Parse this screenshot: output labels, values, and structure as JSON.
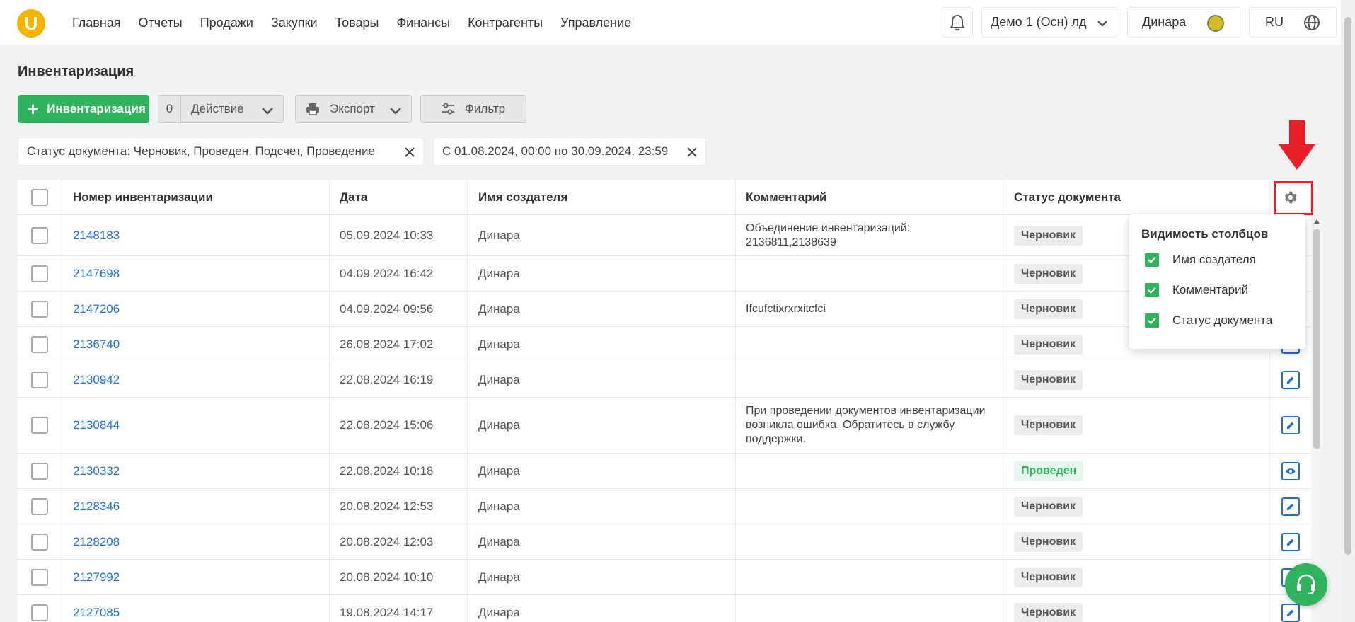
{
  "nav": [
    "Главная",
    "Отчеты",
    "Продажи",
    "Закупки",
    "Товары",
    "Финансы",
    "Контрагенты",
    "Управление"
  ],
  "logo_letter": "U",
  "topbar": {
    "org": "Демо 1 (Осн) лд",
    "user": "Динара",
    "lang": "RU"
  },
  "page": {
    "title": "Инвентаризация"
  },
  "toolbar": {
    "add_label": "Инвентаризация",
    "action_count": "0",
    "action_label": "Действие",
    "export_label": "Экспорт",
    "filter_label": "Фильтр"
  },
  "chips": [
    "Статус документа: Черновик, Проведен, Подсчет, Проведение",
    "С 01.08.2024, 00:00 по 30.09.2024, 23:59"
  ],
  "table": {
    "headers": [
      "Номер инвентаризации",
      "Дата",
      "Имя создателя",
      "Комментарий",
      "Статус документа"
    ],
    "rows": [
      {
        "number": "2148183",
        "date": "05.09.2024 10:33",
        "creator": "Динара",
        "comment": "Объединение инвентаризаций: 2136811,2138639",
        "status": "Черновик",
        "status_type": "draft",
        "action": "edit"
      },
      {
        "number": "2147698",
        "date": "04.09.2024 16:42",
        "creator": "Динара",
        "comment": "",
        "status": "Черновик",
        "status_type": "draft",
        "action": "edit"
      },
      {
        "number": "2147206",
        "date": "04.09.2024 09:56",
        "creator": "Динара",
        "comment": "Ifcufctixrxrxitcfci",
        "status": "Черновик",
        "status_type": "draft",
        "action": "edit"
      },
      {
        "number": "2136740",
        "date": "26.08.2024 17:02",
        "creator": "Динара",
        "comment": "",
        "status": "Черновик",
        "status_type": "draft",
        "action": "edit"
      },
      {
        "number": "2130942",
        "date": "22.08.2024 16:19",
        "creator": "Динара",
        "comment": "",
        "status": "Черновик",
        "status_type": "draft",
        "action": "edit"
      },
      {
        "number": "2130844",
        "date": "22.08.2024 15:06",
        "creator": "Динара",
        "comment": "При проведении документов инвентаризации возникла ошибка. Обратитесь в службу поддержки.",
        "status": "Черновик",
        "status_type": "draft",
        "action": "edit"
      },
      {
        "number": "2130332",
        "date": "22.08.2024 10:18",
        "creator": "Динара",
        "comment": "",
        "status": "Проведен",
        "status_type": "posted",
        "action": "view"
      },
      {
        "number": "2128346",
        "date": "20.08.2024 12:53",
        "creator": "Динара",
        "comment": "",
        "status": "Черновик",
        "status_type": "draft",
        "action": "edit"
      },
      {
        "number": "2128208",
        "date": "20.08.2024 12:03",
        "creator": "Динара",
        "comment": "",
        "status": "Черновик",
        "status_type": "draft",
        "action": "edit"
      },
      {
        "number": "2127992",
        "date": "20.08.2024 10:10",
        "creator": "Динара",
        "comment": "",
        "status": "Черновик",
        "status_type": "draft",
        "action": "edit"
      },
      {
        "number": "2127085",
        "date": "19.08.2024 14:17",
        "creator": "Динара",
        "comment": "",
        "status": "Черновик",
        "status_type": "draft",
        "action": "edit"
      }
    ]
  },
  "column_popup": {
    "title": "Видимость столбцов",
    "items": [
      {
        "label": "Имя создателя",
        "checked": true
      },
      {
        "label": "Комментарий",
        "checked": true
      },
      {
        "label": "Статус документа",
        "checked": true
      }
    ]
  },
  "colors": {
    "accent_green": "#2fb35c",
    "link_blue": "#1f6fd6",
    "highlight_red": "#e8202a",
    "logo_yellow": "#f4b400"
  }
}
